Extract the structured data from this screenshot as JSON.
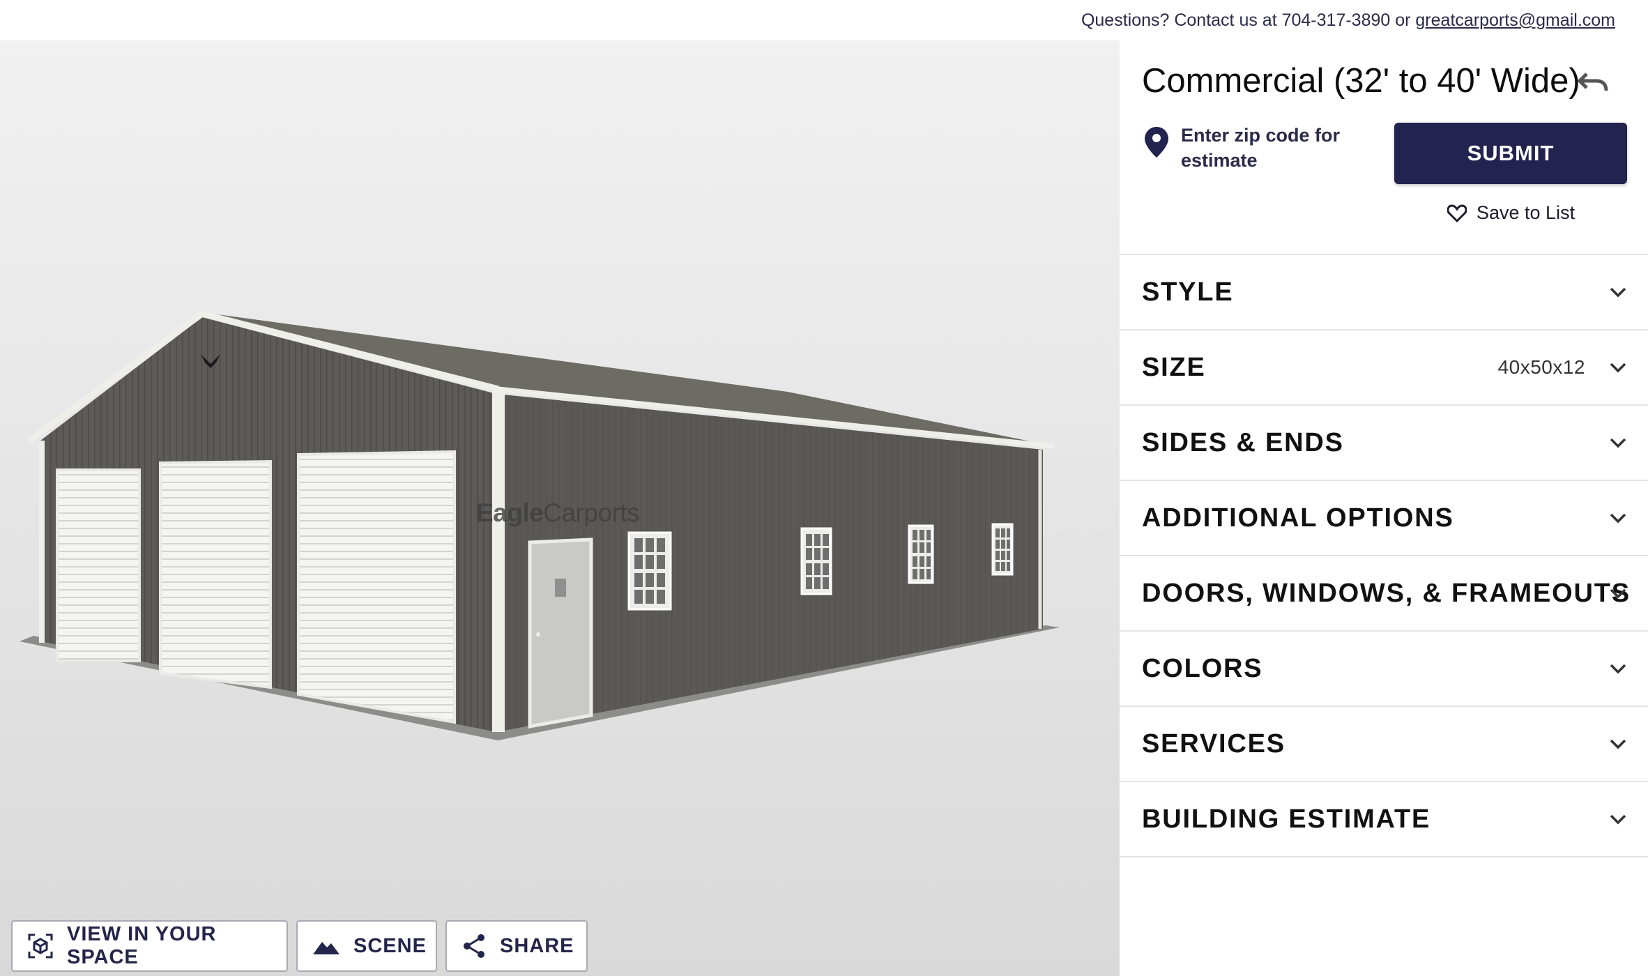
{
  "topbar": {
    "contact_prefix": "Questions? Contact us at 704-317-3890 or ",
    "email": "greatcarports@gmail.com"
  },
  "viewer": {
    "watermark_bold": "Eagle",
    "watermark_regular": "Carports",
    "tools": [
      {
        "label": "VIEW IN YOUR SPACE",
        "icon": "ar-cube-icon"
      },
      {
        "label": "SCENE",
        "icon": "mountain-icon"
      },
      {
        "label": "SHARE",
        "icon": "share-icon"
      }
    ],
    "colors": {
      "wall": "#5b5a57",
      "roof": "#6c6c64",
      "trim": "#efefea",
      "door": "#f2f2ef"
    }
  },
  "panel": {
    "title": "Commercial (32' to 40' Wide)",
    "zip_prompt": "Enter zip code for estimate",
    "submit_label": "SUBMIT",
    "save_label": "Save to List",
    "accent": "#23234f",
    "sections": [
      {
        "label": "STYLE",
        "value": ""
      },
      {
        "label": "SIZE",
        "value": "40x50x12"
      },
      {
        "label": "SIDES & ENDS",
        "value": ""
      },
      {
        "label": "ADDITIONAL OPTIONS",
        "value": ""
      },
      {
        "label": "DOORS, WINDOWS, & FRAMEOUTS",
        "value": ""
      },
      {
        "label": "COLORS",
        "value": ""
      },
      {
        "label": "SERVICES",
        "value": ""
      },
      {
        "label": "BUILDING ESTIMATE",
        "value": ""
      }
    ]
  }
}
